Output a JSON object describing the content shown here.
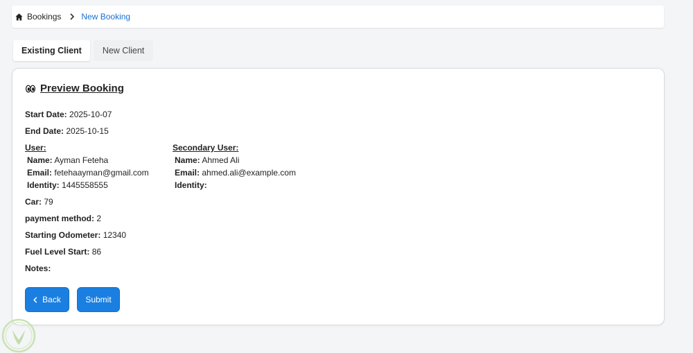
{
  "breadcrumb": {
    "home_icon": "home-icon",
    "first": "Bookings",
    "separator_icon": "chevron-right-icon",
    "current": "New Booking"
  },
  "tabs": [
    {
      "label": "Existing Client",
      "active": true
    },
    {
      "label": "New Client",
      "active": false
    }
  ],
  "preview": {
    "icon": "eyes-icon",
    "title": "Preview Booking",
    "start_date_label": "Start Date:",
    "start_date": "2025-10-07",
    "end_date_label": "End Date:",
    "end_date": "2025-10-15",
    "user": {
      "heading": "User:",
      "name_label": "Name:",
      "name": "Ayman Feteha",
      "email_label": "Email:",
      "email": "fetehaayman@gmail.com",
      "identity_label": "Identity:",
      "identity": "1445558555"
    },
    "secondary_user": {
      "heading": "Secondary User:",
      "name_label": "Name:",
      "name": "Ahmed Ali",
      "email_label": "Email:",
      "email": "ahmed.ali@example.com",
      "identity_label": "Identity:",
      "identity": ""
    },
    "car_label": "Car:",
    "car": "79",
    "payment_label": "payment method:",
    "payment": "2",
    "odometer_label": "Starting Odometer:",
    "odometer": "12340",
    "fuel_label": "Fuel Level Start:",
    "fuel": "86",
    "notes_label": "Notes:",
    "notes": ""
  },
  "buttons": {
    "back_icon": "chevron-left-icon",
    "back": "Back",
    "submit": "Submit"
  },
  "colors": {
    "accent": "#1a7fe0",
    "link": "#1a6fd1"
  }
}
